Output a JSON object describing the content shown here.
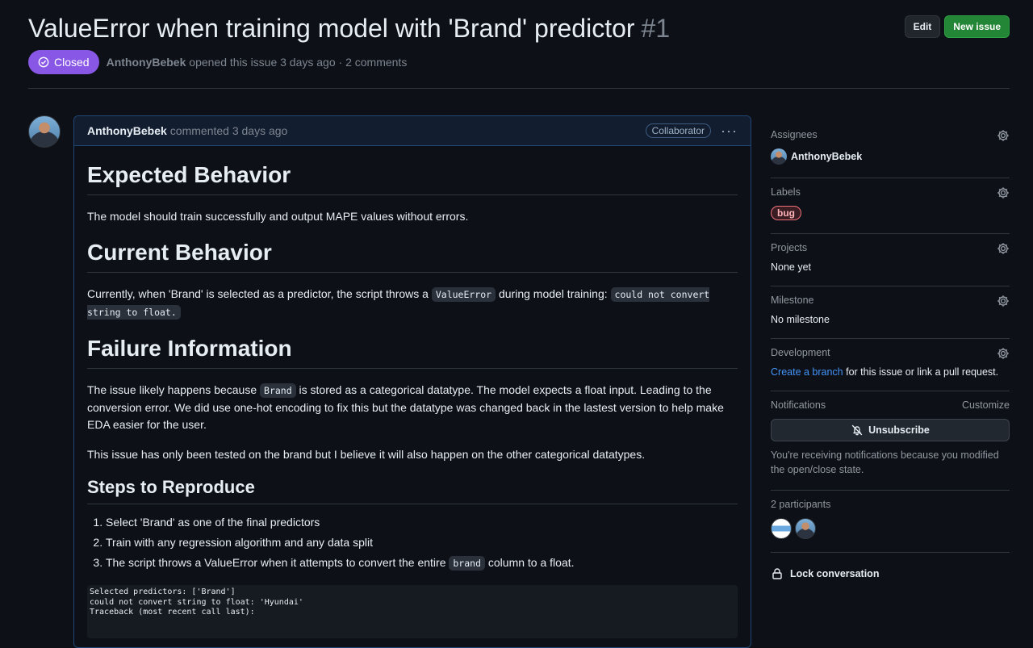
{
  "issue": {
    "title": "ValueError when training model with 'Brand' predictor",
    "number": "#1",
    "state": "Closed",
    "author": "AnthonyBebek",
    "opened_text": "opened this issue 3 days ago · 2 comments"
  },
  "header_actions": {
    "edit": "Edit",
    "new_issue": "New issue"
  },
  "comment": {
    "author": "AnthonyBebek",
    "when": "commented 3 days ago",
    "role": "Collaborator",
    "expected_h": "Expected Behavior",
    "expected_p": "The model should train successfully and output MAPE values without errors.",
    "current_h": "Current Behavior",
    "current_p1": "Currently, when 'Brand' is selected as a predictor, the script throws a ",
    "current_code1": "ValueError",
    "current_p2": " during model training: ",
    "current_code2": "could not convert string to float.",
    "failure_h": "Failure Information",
    "failure_p1a": "The issue likely happens because ",
    "failure_code": "Brand",
    "failure_p1b": " is stored as a categorical datatype. The model expects a float input. Leading to the conversion error. We did use one-hot encoding to fix this but the datatype was changed back in the lastest version to help make EDA easier for the user.",
    "failure_p2": "This issue has only been tested on the brand but I believe it will also happen on the other categorical datatypes.",
    "steps_h": "Steps to Reproduce",
    "steps": [
      "Select 'Brand' as one of the final predictors",
      "Train with any regression algorithm and any data split"
    ],
    "step3_a": "The script throws a ValueError when it attempts to convert the entire ",
    "step3_code": "brand",
    "step3_b": " column to a float.",
    "code_lines": [
      "Selected predictors: ['Brand']",
      "could not convert string to float: 'Hyundai'",
      "Traceback (most recent call last):"
    ]
  },
  "sidebar": {
    "assignees_title": "Assignees",
    "assignee": "AnthonyBebek",
    "labels_title": "Labels",
    "label": "bug",
    "projects_title": "Projects",
    "projects_val": "None yet",
    "milestone_title": "Milestone",
    "milestone_val": "No milestone",
    "development_title": "Development",
    "dev_link": "Create a branch",
    "dev_text": " for this issue or link a pull request.",
    "notifications_title": "Notifications",
    "customize": "Customize",
    "unsubscribe": "Unsubscribe",
    "notif_note": "You're receiving notifications because you modified the open/close state.",
    "participants_title": "2 participants",
    "lock": "Lock conversation"
  },
  "colors": {
    "closed_badge": "#8957e5",
    "primary_button": "#238636",
    "link": "#4493f8",
    "bug_label": "#f0707a"
  }
}
